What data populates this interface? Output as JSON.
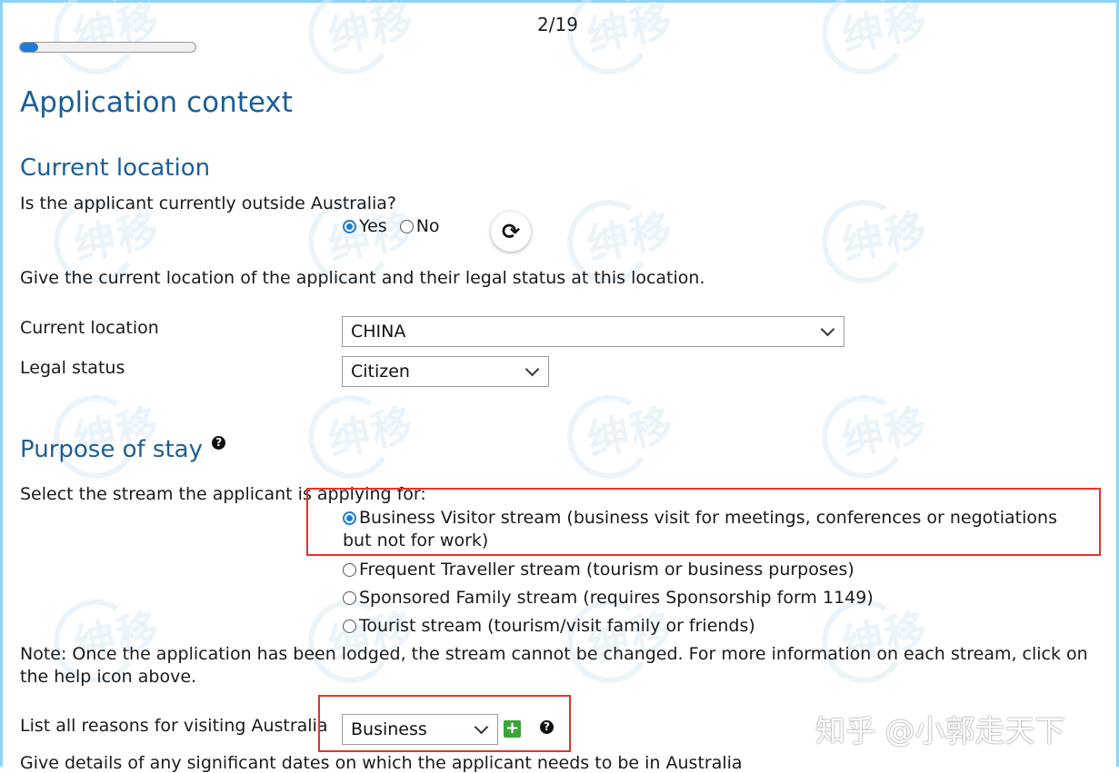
{
  "progress": {
    "counter": "2/19",
    "fraction": 0.105
  },
  "headings": {
    "page_title": "Application context",
    "current_location": "Current location",
    "purpose_of_stay": "Purpose of stay"
  },
  "questions": {
    "outside_australia": "Is the applicant currently outside Australia?",
    "yes_label": "Yes",
    "no_label": "No",
    "location_intro": "Give the current location of the applicant and their legal status at this location.",
    "select_stream": "Select the stream the applicant is applying for:"
  },
  "fields": {
    "current_location_label": "Current location",
    "current_location_value": "CHINA",
    "legal_status_label": "Legal status",
    "legal_status_value": "Citizen",
    "reasons_label": "List all reasons for visiting Australia",
    "reasons_value": "Business"
  },
  "streams": [
    {
      "label": "Business Visitor stream (business visit for meetings, conferences or negotiations but not for work)",
      "selected": true
    },
    {
      "label": "Frequent Traveller stream (tourism or business purposes)",
      "selected": false
    },
    {
      "label": "Sponsored Family stream (requires Sponsorship form 1149)",
      "selected": false
    },
    {
      "label": "Tourist stream (tourism/visit family or friends)",
      "selected": false
    }
  ],
  "note": "Note: Once the application has been lodged, the stream cannot be changed. For more information on each stream, click on the help icon above.",
  "significant_dates": "Give details of any significant dates on which the applicant needs to be in Australia",
  "help_icon_glyph": "?",
  "add_icon_glyph": "+",
  "reload_glyph": "⟳",
  "watermark_text": "绅移",
  "brand_watermark": "知乎 @小郭走天下",
  "colors": {
    "accent": "#1b5f97",
    "radio": "#1e7bd4",
    "highlight": "#e8312b",
    "frame": "#8fd3f4"
  }
}
